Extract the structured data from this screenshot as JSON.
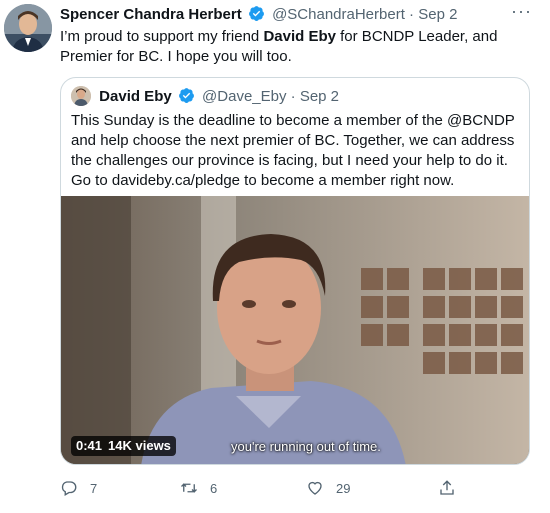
{
  "tweet": {
    "author_name": "Spencer Chandra Herbert",
    "author_handle": "@SChandraHerbert",
    "separator": "·",
    "date": "Sep 2",
    "more": "···",
    "text_before": "I’m proud to support my friend ",
    "text_bold": "David Eby",
    "text_after": " for BCNDP Leader, and Premier for BC. I hope you will too."
  },
  "quote": {
    "author_name": "David Eby",
    "author_handle": "@Dave_Eby",
    "separator": "·",
    "date": "Sep 2",
    "text": "This Sunday is the deadline to become a member of the @BCNDP and help choose the next premier of BC. Together, we can address the challenges our province is facing, but I need your help to do it. Go to davideby.ca/pledge to become a member right now.",
    "video": {
      "duration": "0:41",
      "views": "14K views",
      "caption": "you're running out of time."
    }
  },
  "actions": {
    "reply_count": "7",
    "retweet_count": "6",
    "like_count": "29"
  },
  "colors": {
    "verified": "#1d9bf0",
    "secondary_text": "#536471",
    "border": "#cfd9de"
  }
}
